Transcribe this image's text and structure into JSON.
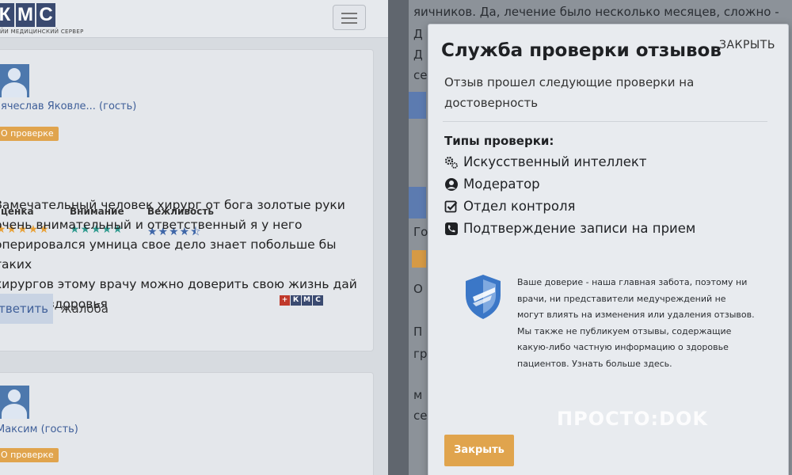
{
  "header": {
    "logo_letters": [
      "К",
      "М",
      "С"
    ],
    "logo_subtitle": "ЙИ МЕДИЦИНСКИЙ СЕРВЕР"
  },
  "reviews": [
    {
      "author": "ячеслав Яковле... (гость)",
      "badge": "О проверке",
      "ratings": [
        {
          "label": "ценка",
          "stars": "★★★★★",
          "color": "#e8a23a"
        },
        {
          "label": "Внимание",
          "stars": "★★★★★",
          "color": "#2e9a8e"
        },
        {
          "label": "Вежливость",
          "stars": "★★★★⯪",
          "color": "#3e66a8"
        }
      ],
      "text_lines": [
        "Замечательный человек хирург от бога золотые руки",
        "очень внимательный и ответственный я у него",
        "оперировался умница свое дело знает побольше бы таких",
        "хирургов этому врачу можно доверить свою жизнь дай",
        "ему бог здоровья"
      ],
      "reply_label": "тветить",
      "complaint_label": "жалоба",
      "mini_logo": [
        "+",
        "К",
        "М",
        "С"
      ]
    },
    {
      "author": "Максим (гость)",
      "badge": "О проверке"
    }
  ],
  "background_page": {
    "lines": [
      "яичников. Да, лечение было несколько месяцев, сложно -",
      "Д",
      "Д",
      "се",
      "Го",
      "О",
      "П",
      "гр",
      "м",
      "се"
    ]
  },
  "modal": {
    "title": "Служба проверки отзывов",
    "close_link": "ЗАКРЫТЬ",
    "subtitle": "Отзыв прошел следующие проверки на достоверность",
    "types_title": "Типы проверки:",
    "checks": [
      {
        "icon": "gears-icon",
        "label": "Искусственный интеллект"
      },
      {
        "icon": "user-circle-icon",
        "label": "Модератор"
      },
      {
        "icon": "checkbox-icon",
        "label": "Отдел контроля"
      },
      {
        "icon": "phone-icon",
        "label": "Подтверждение записи на прием"
      }
    ],
    "trust_text": "Ваше доверие - наша главная забота, поэтому ни врачи, ни представители медучреждений не могут влиять на изменения или удаления отзывов. Мы также не публикуем отзывы, содержащие какую-либо частную информацию о здоровье пациентов. Узнать больше здесь.",
    "watermark": "ПРОСТО:DOK",
    "close_button": "Закрыть",
    "colors": {
      "accent": "#e0a44d",
      "shield": "#3b77c7"
    }
  }
}
